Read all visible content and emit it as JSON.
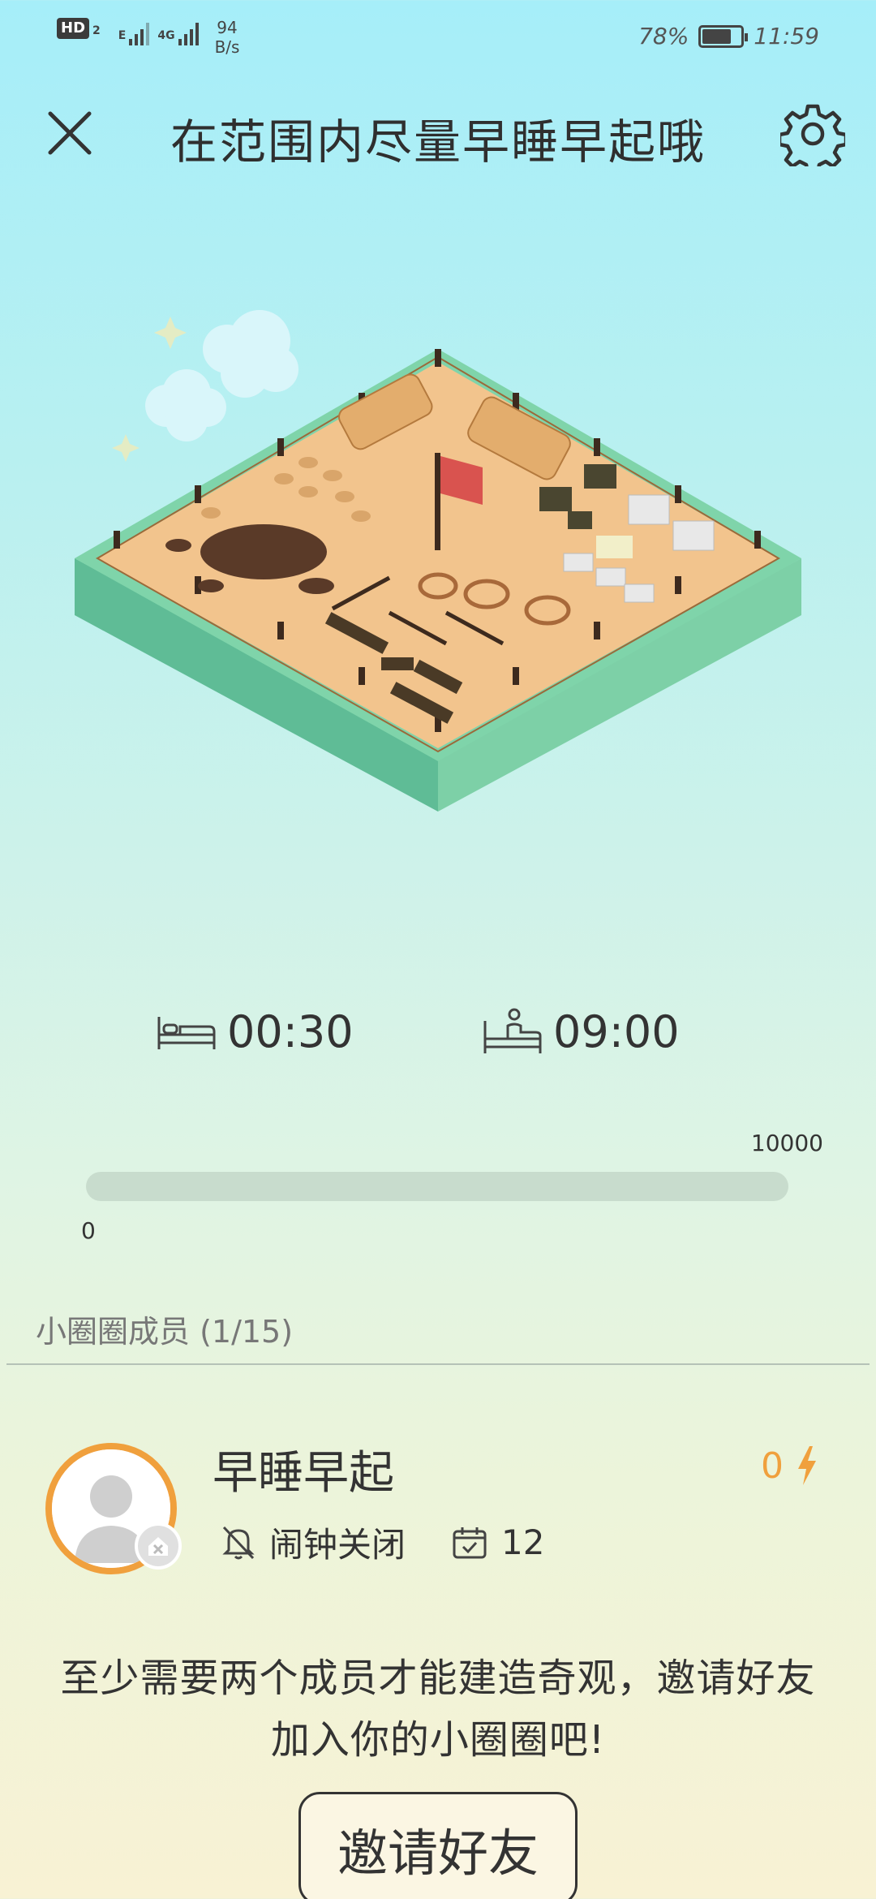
{
  "status_bar": {
    "hd_label": "HD",
    "hd_sub": "2",
    "net1": "E",
    "net2": "4G",
    "speed_value": "94",
    "speed_unit": "B/s",
    "battery": "78%",
    "time": "11:59"
  },
  "header": {
    "title": "在范围内尽量早睡早起哦"
  },
  "sleep": {
    "bed_time": "00:30",
    "wake_time": "09:00"
  },
  "progress": {
    "min": "0",
    "max": "10000",
    "value_fraction": 0
  },
  "members": {
    "title": "小圈圈成员 (1/15)",
    "items": [
      {
        "name": "早睡早起",
        "energy": "0",
        "alarm_status": "闹钟关闭",
        "checkin_days": "12"
      }
    ]
  },
  "invite": {
    "text_line1": "至少需要两个成员才能建造奇观，邀请好友",
    "text_line2": "加入你的小圈圈吧!",
    "button_label": "邀请好友"
  },
  "colors": {
    "accent_orange": "#f0a03d",
    "progress_track": "#c8dccd"
  }
}
